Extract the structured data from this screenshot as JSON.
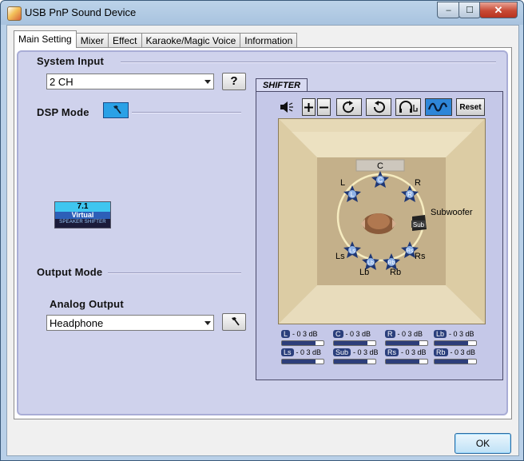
{
  "window": {
    "title": "USB PnP Sound Device",
    "close_glyph": "✕",
    "maximize_glyph": "☐",
    "minimize_glyph": "–"
  },
  "tabs": [
    "Main Setting",
    "Mixer",
    "Effect",
    "Karaoke/Magic Voice",
    "Information"
  ],
  "active_tab": "Main Setting",
  "system_input": {
    "heading": "System Input",
    "value": "2 CH",
    "help_label": "?"
  },
  "dsp_mode": {
    "heading": "DSP Mode",
    "logo_lines": [
      "7.1",
      "Virtual",
      "SPEAKER SHIFTER"
    ]
  },
  "output_mode": {
    "heading": "Output Mode",
    "analog_heading": "Analog Output",
    "value": "Headphone"
  },
  "shifter": {
    "tab_label": "SHIFTER",
    "reset_label": "Reset",
    "toolbar_icons": [
      "speaker-mute-icon",
      "plus-icon",
      "minus-icon",
      "rotate-cw-icon",
      "rotate-ccw-icon",
      "headphone-icon",
      "wave-icon"
    ],
    "speakers": [
      {
        "id": "C",
        "label": "C"
      },
      {
        "id": "L",
        "label": "L"
      },
      {
        "id": "R",
        "label": "R"
      },
      {
        "id": "Sub",
        "label": "Subwoofer"
      },
      {
        "id": "Ls",
        "label": "Ls"
      },
      {
        "id": "Lb",
        "label": "Lb"
      },
      {
        "id": "Rb",
        "label": "Rb"
      },
      {
        "id": "Rs",
        "label": "Rs"
      }
    ],
    "levels": [
      {
        "ch": "L",
        "value": "- 0 3 dB",
        "fraction": 0.8
      },
      {
        "ch": "C",
        "value": "- 0 3 dB",
        "fraction": 0.8
      },
      {
        "ch": "R",
        "value": "- 0 3 dB",
        "fraction": 0.8
      },
      {
        "ch": "Lb",
        "value": "- 0 3 dB",
        "fraction": 0.8
      },
      {
        "ch": "Ls",
        "value": "- 0 3 dB",
        "fraction": 0.8
      },
      {
        "ch": "Sub",
        "value": "- 0 3 dB",
        "fraction": 0.8
      },
      {
        "ch": "Rs",
        "value": "- 0 3 dB",
        "fraction": 0.8
      },
      {
        "ch": "Rb",
        "value": "- 0 3 dB",
        "fraction": 0.8
      }
    ]
  },
  "ok_label": "OK"
}
